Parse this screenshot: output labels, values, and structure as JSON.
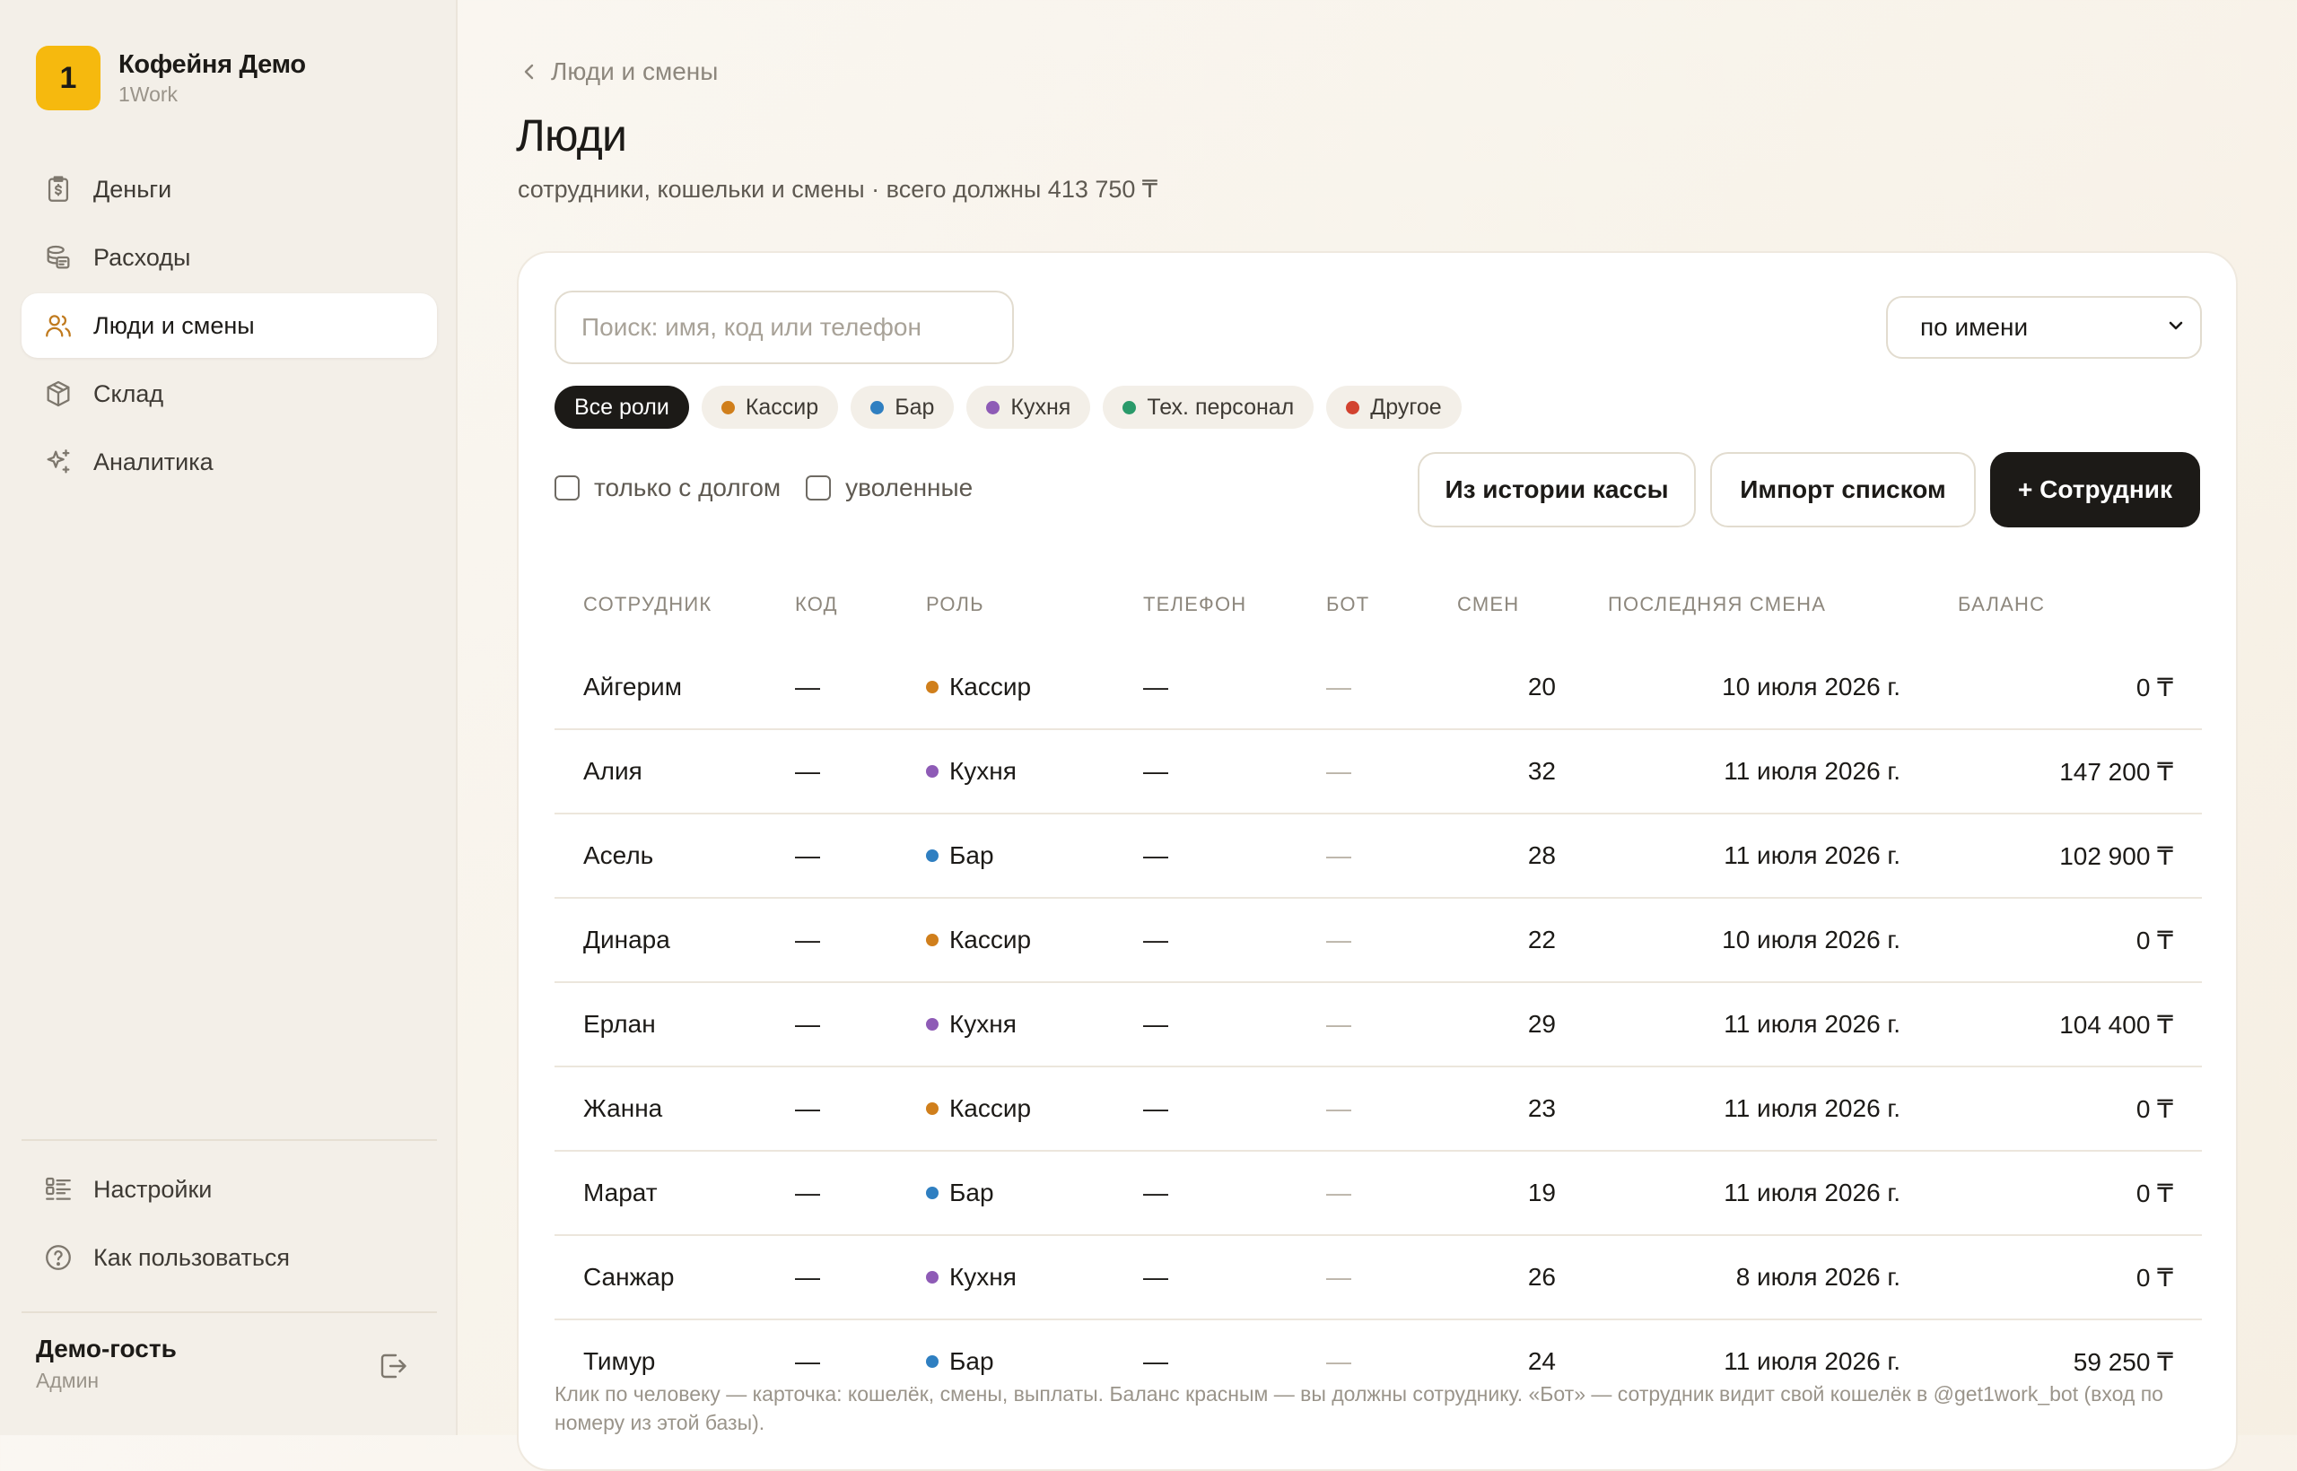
{
  "brand": {
    "logo_char": "1",
    "name": "Кофейня Демо",
    "sub": "1Work"
  },
  "nav_top": [
    {
      "label": "Деньги",
      "icon": "money-icon",
      "active": false
    },
    {
      "label": "Расходы",
      "icon": "expenses-icon",
      "active": false
    },
    {
      "label": "Люди и смены",
      "icon": "people-icon",
      "active": true
    },
    {
      "label": "Склад",
      "icon": "warehouse-icon",
      "active": false
    },
    {
      "label": "Аналитика",
      "icon": "sparkle-icon",
      "active": false
    }
  ],
  "nav_bottom": [
    {
      "label": "Настройки",
      "icon": "settings-list-icon"
    },
    {
      "label": "Как пользоваться",
      "icon": "help-icon"
    }
  ],
  "user": {
    "name": "Демо-гость",
    "role": "Админ"
  },
  "header": {
    "breadcrumb": "Люди и смены",
    "title": "Люди",
    "subtitle": "сотрудники, кошельки и смены · всего должны 413 750 ₸"
  },
  "filters": {
    "search_placeholder": "Поиск: имя, код или телефон",
    "sort_value": "по имени",
    "roles": [
      {
        "label": "Все роли",
        "color": "",
        "active": true
      },
      {
        "label": "Кассир",
        "color": "#d07f1c",
        "active": false
      },
      {
        "label": "Бар",
        "color": "#2f7fc1",
        "active": false
      },
      {
        "label": "Кухня",
        "color": "#8e5bb6",
        "active": false
      },
      {
        "label": "Тех. персонал",
        "color": "#2a9a6a",
        "active": false
      },
      {
        "label": "Другое",
        "color": "#d2422f",
        "active": false
      }
    ],
    "only_debt": "только с долгом",
    "fired": "уволенные"
  },
  "actions": {
    "from_history": "Из истории кассы",
    "import_list": "Импорт списком",
    "add_employee": "+ Сотрудник"
  },
  "table": {
    "columns": [
      "СОТРУДНИК",
      "КОД",
      "РОЛЬ",
      "ТЕЛЕФОН",
      "БОТ",
      "СМЕН",
      "ПОСЛЕДНЯЯ СМЕНА",
      "БАЛАНС"
    ],
    "rows": [
      {
        "name": "Айгерим",
        "code": "—",
        "role": "Кассир",
        "role_color": "#d07f1c",
        "phone": "—",
        "bot": "—",
        "shifts": "20",
        "last": "10 июля 2026 г.",
        "balance": "0 ₸",
        "debt": false
      },
      {
        "name": "Алия",
        "code": "—",
        "role": "Кухня",
        "role_color": "#8e5bb6",
        "phone": "—",
        "bot": "—",
        "shifts": "32",
        "last": "11 июля 2026 г.",
        "balance": "147 200 ₸",
        "debt": true
      },
      {
        "name": "Асель",
        "code": "—",
        "role": "Бар",
        "role_color": "#2f7fc1",
        "phone": "—",
        "bot": "—",
        "shifts": "28",
        "last": "11 июля 2026 г.",
        "balance": "102 900 ₸",
        "debt": true
      },
      {
        "name": "Динара",
        "code": "—",
        "role": "Кассир",
        "role_color": "#d07f1c",
        "phone": "—",
        "bot": "—",
        "shifts": "22",
        "last": "10 июля 2026 г.",
        "balance": "0 ₸",
        "debt": false
      },
      {
        "name": "Ерлан",
        "code": "—",
        "role": "Кухня",
        "role_color": "#8e5bb6",
        "phone": "—",
        "bot": "—",
        "shifts": "29",
        "last": "11 июля 2026 г.",
        "balance": "104 400 ₸",
        "debt": true
      },
      {
        "name": "Жанна",
        "code": "—",
        "role": "Кассир",
        "role_color": "#d07f1c",
        "phone": "—",
        "bot": "—",
        "shifts": "23",
        "last": "11 июля 2026 г.",
        "balance": "0 ₸",
        "debt": false
      },
      {
        "name": "Марат",
        "code": "—",
        "role": "Бар",
        "role_color": "#2f7fc1",
        "phone": "—",
        "bot": "—",
        "shifts": "19",
        "last": "11 июля 2026 г.",
        "balance": "0 ₸",
        "debt": false
      },
      {
        "name": "Санжар",
        "code": "—",
        "role": "Кухня",
        "role_color": "#8e5bb6",
        "phone": "—",
        "bot": "—",
        "shifts": "26",
        "last": "8 июля 2026 г.",
        "balance": "0 ₸",
        "debt": false
      },
      {
        "name": "Тимур",
        "code": "—",
        "role": "Бар",
        "role_color": "#2f7fc1",
        "phone": "—",
        "bot": "—",
        "shifts": "24",
        "last": "11 июля 2026 г.",
        "balance": "59 250 ₸",
        "debt": true
      }
    ]
  },
  "footnote": "Клик по человеку — карточка: кошелёк, смены, выплаты. Баланс красным — вы должны сотруднику. «Бот» — сотрудник видит свой кошелёк в @get1work_bot (вход по номеру из этой базы).",
  "colors": {
    "accent": "#f6b90e",
    "debt": "#cd3b2b",
    "dark": "#1c1a17"
  }
}
